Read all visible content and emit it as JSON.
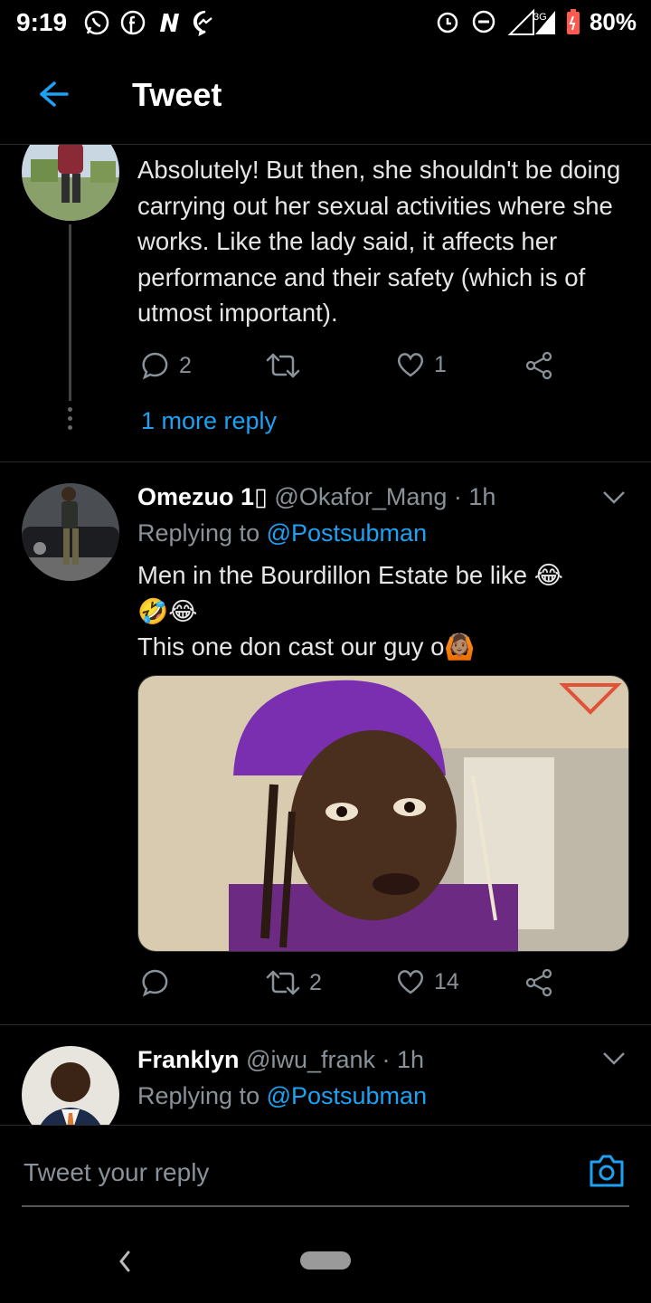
{
  "status_bar": {
    "time": "9:19",
    "network": "3G",
    "battery": "80%"
  },
  "header": {
    "title": "Tweet"
  },
  "tweet1": {
    "text": "Absolutely! But then, she shouldn't be doing carrying out her sexual activities where she works. Like the lady said, it affects her performance and their safety (which is of utmost important).",
    "replies": "2",
    "retweets": "",
    "likes": "1",
    "more_reply": "1 more reply"
  },
  "tweet2": {
    "name": "Omezuo 1▯",
    "handle": "@Okafor_Mang",
    "time": "· 1h",
    "replying_prefix": "Replying to ",
    "replying_to": "@Postsubman",
    "text_line1": "Men in the Bourdillon Estate be like 😂",
    "text_line2": "🤣😂",
    "text_line3": "This one don cast our guy o🙆🏽",
    "replies": "",
    "retweets": "2",
    "likes": "14"
  },
  "tweet3": {
    "name": "Franklyn",
    "handle": "@iwu_frank",
    "time": "· 1h",
    "replying_prefix": "Replying to ",
    "replying_to": "@Postsubman"
  },
  "compose": {
    "placeholder": "Tweet your reply"
  },
  "colors": {
    "accent": "#1da1f2",
    "muted": "#8a9299",
    "background": "#000000"
  }
}
